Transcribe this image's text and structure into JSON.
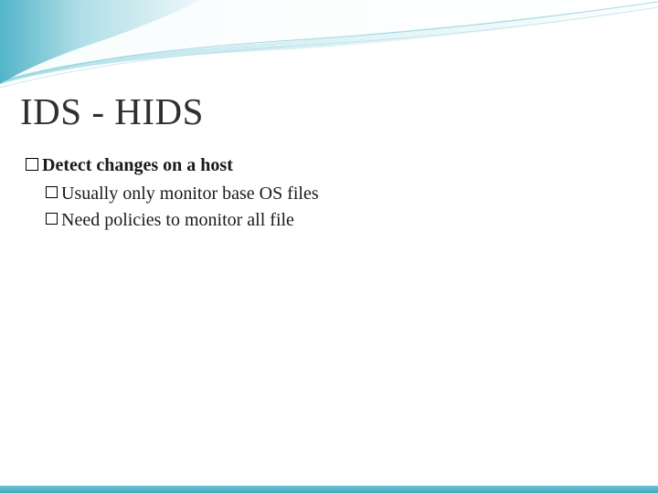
{
  "title": "IDS - HIDS",
  "body": {
    "level1": [
      {
        "text": "Detect changes on a host",
        "children": [
          "Usually only monitor base OS files",
          "Need policies to monitor all file"
        ]
      }
    ]
  }
}
